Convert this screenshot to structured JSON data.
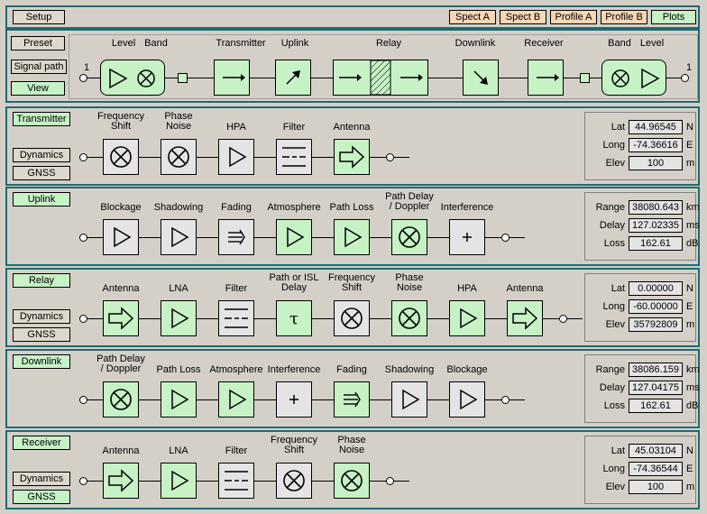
{
  "setup": {
    "setup_label": "Setup",
    "tabs": [
      "Spect A",
      "Spect B",
      "Profile A",
      "Profile B",
      "Plots"
    ]
  },
  "overview": {
    "side_buttons": {
      "preset": "Preset",
      "signal_path": "Signal path",
      "view": "View"
    },
    "port_in": "1",
    "port_out": "1",
    "labels": {
      "level_l": "Level",
      "band_l": "Band",
      "transmitter": "Transmitter",
      "uplink": "Uplink",
      "relay": "Relay",
      "downlink": "Downlink",
      "receiver": "Receiver",
      "band_r": "Band",
      "level_r": "Level"
    }
  },
  "transmitter": {
    "title": "Transmitter",
    "dynamics": "Dynamics",
    "gnss": "GNSS",
    "blocks": [
      "Frequency\nShift",
      "Phase\nNoise",
      "HPA",
      "Filter",
      "Antenna"
    ],
    "info": [
      {
        "label": "Lat",
        "value": "44.96545",
        "unit": "N"
      },
      {
        "label": "Long",
        "value": "-74.36616",
        "unit": "E"
      },
      {
        "label": "Elev",
        "value": "100",
        "unit": "m"
      }
    ]
  },
  "uplink": {
    "title": "Uplink",
    "blocks": [
      "Blockage",
      "Shadowing",
      "Fading",
      "Atmosphere",
      "Path Loss",
      "Path Delay\n/ Doppler",
      "Interference"
    ],
    "info": [
      {
        "label": "Range",
        "value": "38080.643",
        "unit": "km"
      },
      {
        "label": "Delay",
        "value": "127.02335",
        "unit": "ms"
      },
      {
        "label": "Loss",
        "value": "162.61",
        "unit": "dB"
      }
    ]
  },
  "relay": {
    "title": "Relay",
    "dynamics": "Dynamics",
    "gnss": "GNSS",
    "blocks": [
      "Antenna",
      "LNA",
      "Filter",
      "Path or ISL\nDelay",
      "Frequency\nShift",
      "Phase\nNoise",
      "HPA",
      "Antenna"
    ],
    "info": [
      {
        "label": "Lat",
        "value": "0.00000",
        "unit": "N"
      },
      {
        "label": "Long",
        "value": "-60.00000",
        "unit": "E"
      },
      {
        "label": "Elev",
        "value": "35792809",
        "unit": "m"
      }
    ]
  },
  "downlink": {
    "title": "Downlink",
    "blocks": [
      "Path Delay\n/ Doppler",
      "Path Loss",
      "Atmosphere",
      "Interference",
      "Fading",
      "Shadowing",
      "Blockage"
    ],
    "info": [
      {
        "label": "Range",
        "value": "38086.159",
        "unit": "km"
      },
      {
        "label": "Delay",
        "value": "127.04175",
        "unit": "ms"
      },
      {
        "label": "Loss",
        "value": "162.61",
        "unit": "dB"
      }
    ]
  },
  "receiver": {
    "title": "Receiver",
    "dynamics": "Dynamics",
    "gnss": "GNSS",
    "blocks": [
      "Antenna",
      "LNA",
      "Filter",
      "Frequency\nShift",
      "Phase\nNoise"
    ],
    "info": [
      {
        "label": "Lat",
        "value": "45.03104",
        "unit": "N"
      },
      {
        "label": "Long",
        "value": "-74.36544",
        "unit": "E"
      },
      {
        "label": "Elev",
        "value": "100",
        "unit": "m"
      }
    ]
  },
  "colors": {
    "panel_border": "#1f6a72",
    "active_green": "#c6f2c6",
    "inactive_grey": "#e4e4e4",
    "tab_orange": "#f8d6b4"
  }
}
